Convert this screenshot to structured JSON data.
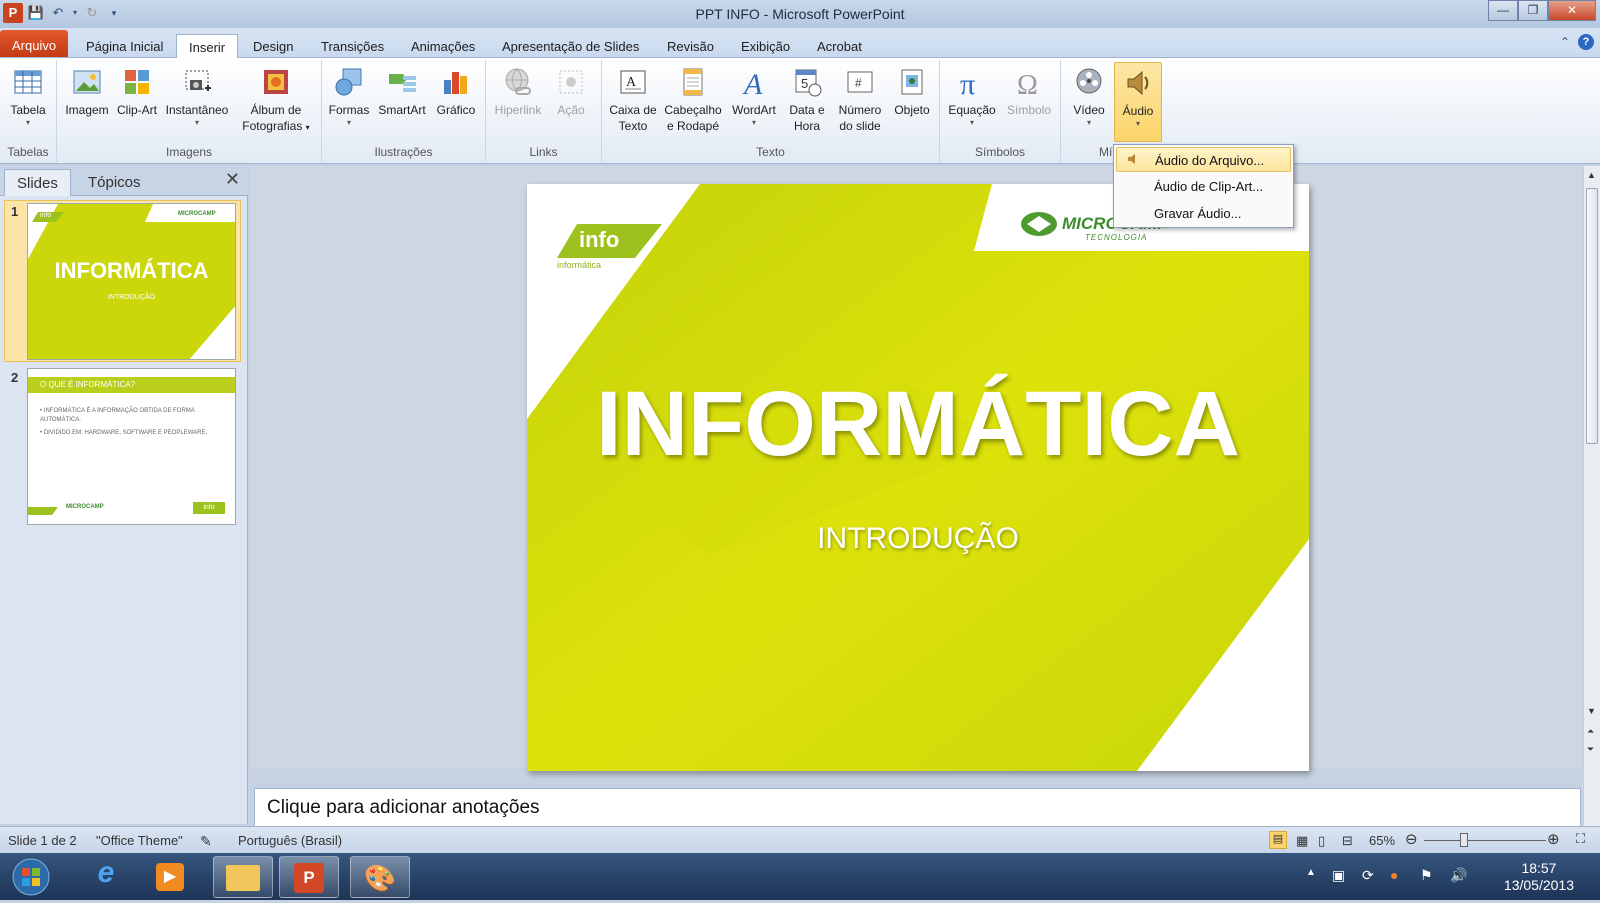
{
  "window": {
    "title": "PPT INFO  -  Microsoft PowerPoint"
  },
  "tabs": [
    "Arquivo",
    "Página Inicial",
    "Inserir",
    "Design",
    "Transições",
    "Animações",
    "Apresentação de Slides",
    "Revisão",
    "Exibição",
    "Acrobat"
  ],
  "active_tab": "Inserir",
  "ribbon": {
    "groups": {
      "tabelas": "Tabelas",
      "imagens": "Imagens",
      "ilustracoes": "Ilustrações",
      "links": "Links",
      "texto": "Texto",
      "simbolos": "Símbolos",
      "midia": "Mí"
    },
    "buttons": {
      "tabela": "Tabela",
      "imagem": "Imagem",
      "clipart": "Clip-Art",
      "instantaneo": "Instantâneo",
      "album_1": "Álbum de",
      "album_2": "Fotografias",
      "formas": "Formas",
      "smartart": "SmartArt",
      "grafico": "Gráfico",
      "hiperlink": "Hiperlink",
      "acao": "Ação",
      "caixa_1": "Caixa de",
      "caixa_2": "Texto",
      "cabecalho_1": "Cabeçalho",
      "cabecalho_2": "e Rodapé",
      "wordart": "WordArt",
      "data_1": "Data e",
      "data_2": "Hora",
      "numero_1": "Número",
      "numero_2": "do slide",
      "objeto": "Objeto",
      "equacao": "Equação",
      "simbolo": "Símbolo",
      "video": "Vídeo",
      "audio": "Áudio"
    }
  },
  "audio_menu": {
    "items": [
      "Áudio do Arquivo...",
      "Áudio de Clip-Art...",
      "Gravar Áudio..."
    ]
  },
  "left_pane": {
    "tabs": [
      "Slides",
      "Tópicos"
    ],
    "slides": [
      {
        "number": "1",
        "title": "INFORMÁTICA",
        "subtitle": "INTRODUÇÃO",
        "logo": "info",
        "brand": "MICROCAMP"
      },
      {
        "number": "2",
        "title": "O QUE É INFORMÁTICA?",
        "bullets": [
          "INFORMÁTICA  É  A INFORMAÇÃO  OBTIDA  DE FORMA AUTOMÁTICA.",
          "DIVIDIDO EM: HARDWARE, SOFTWARE  E PEOPLEWARE."
        ],
        "logo": "info",
        "brand": "MICROCAMP"
      }
    ]
  },
  "slide": {
    "title": "INFORMÁTICA",
    "subtitle": "INTRODUÇÃO",
    "logo_text": "info",
    "logo_sub": "informática",
    "brand": "MICROCAMP",
    "brand_sub": "TECNOLOGIA"
  },
  "notes": {
    "placeholder": "Clique para adicionar anotações"
  },
  "status": {
    "slide": "Slide 1 de 2",
    "theme": "\"Office Theme\"",
    "language": "Português (Brasil)",
    "zoom": "65%"
  },
  "taskbar": {
    "time": "18:57",
    "date": "13/05/2013"
  },
  "colors": {
    "slide_bg": "#cbd70a",
    "file_tab": "#d14d24",
    "accent_green": "#9dc21e"
  }
}
